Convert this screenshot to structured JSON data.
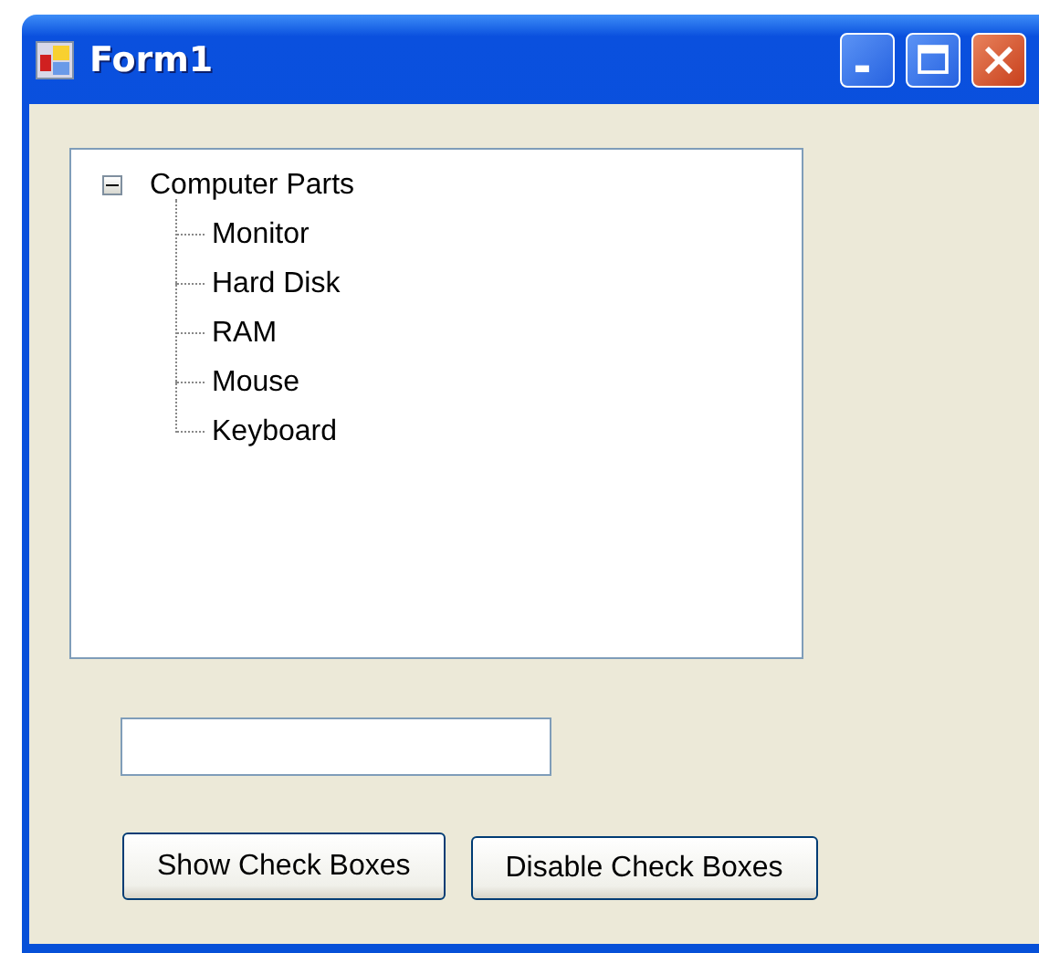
{
  "window": {
    "title": "Form1"
  },
  "tree": {
    "nodes": [
      {
        "label": "Computer Parts",
        "expanded": true,
        "children": [
          {
            "label": "Monitor"
          },
          {
            "label": "Hard Disk"
          },
          {
            "label": "RAM"
          },
          {
            "label": "Mouse"
          },
          {
            "label": "Keyboard"
          }
        ]
      }
    ]
  },
  "buttons": [
    {
      "label": "Show Check Boxes"
    },
    {
      "label": "Disable Check Boxes"
    }
  ]
}
